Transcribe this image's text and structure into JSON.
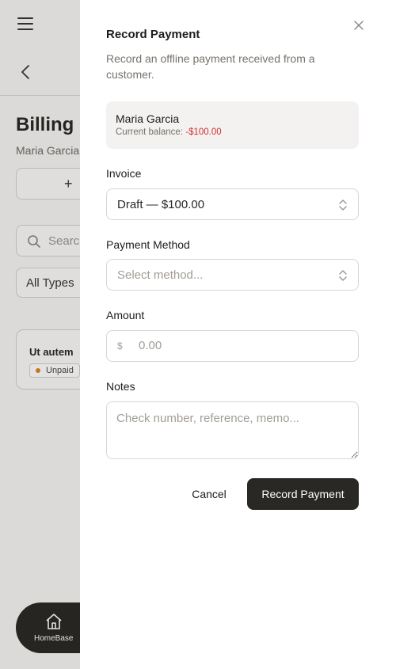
{
  "background": {
    "page_title": "Billing H",
    "customer_name": "Maria Garcia",
    "add_button_label": "+",
    "search_placeholder": "Searc",
    "filter_value": "All Types",
    "card_title": "Ut autem",
    "card_status": "Unpaid",
    "nav_label": "HomeBase"
  },
  "dialog": {
    "title": "Record Payment",
    "description": "Record an offline payment received from a customer.",
    "customer": {
      "name": "Maria Garcia",
      "balance_label": "Current balance:",
      "balance_value": "-$100.00"
    },
    "invoice": {
      "label": "Invoice",
      "selected": "Draft — $100.00"
    },
    "payment_method": {
      "label": "Payment Method",
      "placeholder": "Select method..."
    },
    "amount": {
      "label": "Amount",
      "currency_symbol": "$",
      "placeholder": "0.00"
    },
    "notes": {
      "label": "Notes",
      "placeholder": "Check number, reference, memo..."
    },
    "cancel_label": "Cancel",
    "submit_label": "Record Payment"
  },
  "colors": {
    "accent_dark": "#2a2825",
    "negative_balance": "#d12f2f",
    "status_unpaid_dot": "#e0861e"
  },
  "icons": [
    "menu-icon",
    "chevron-left-icon",
    "search-icon",
    "home-icon",
    "close-icon",
    "chevron-up-down-icon"
  ]
}
